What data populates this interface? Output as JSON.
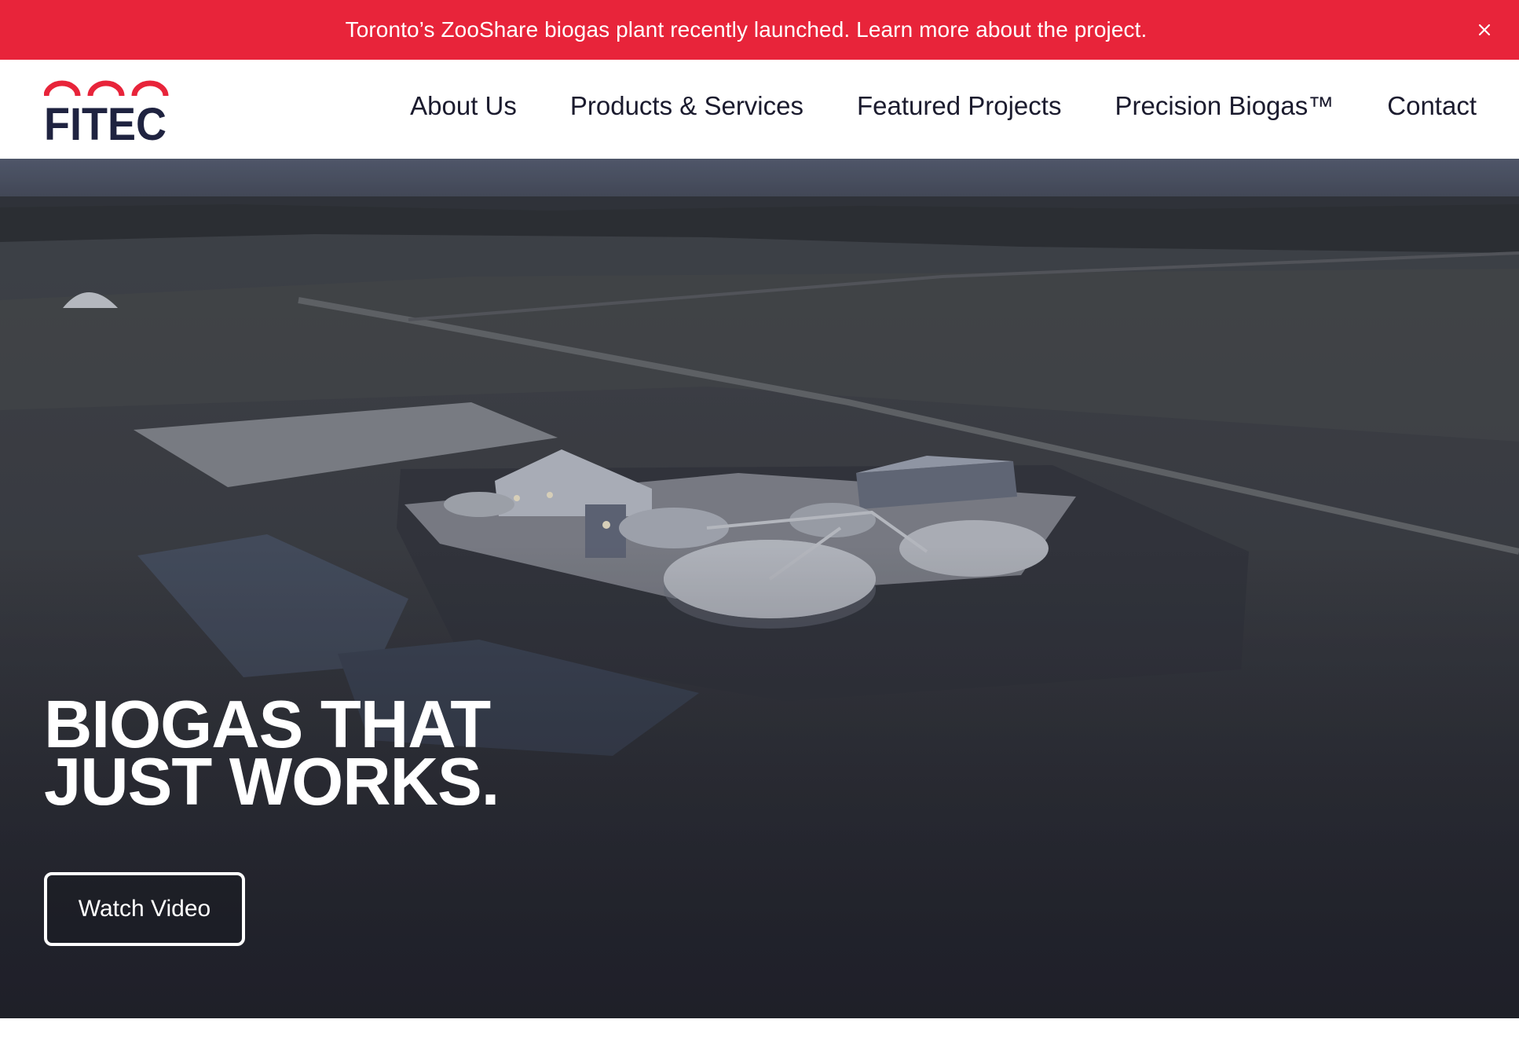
{
  "banner": {
    "text": "Toronto’s ZooShare biogas plant recently launched. Learn more about the project.",
    "close_icon": "close-icon",
    "background_color": "#e8243a"
  },
  "header": {
    "logo_text": "FITEC",
    "logo_icon": "three-arches-logo-mark",
    "logo_colors": {
      "arches": "#e8243a",
      "text": "#1f2340"
    },
    "nav": [
      {
        "label": "About Us"
      },
      {
        "label": "Products & Services"
      },
      {
        "label": "Featured Projects"
      },
      {
        "label": "Precision Biogas™"
      },
      {
        "label": "Contact"
      }
    ]
  },
  "hero": {
    "background": "aerial-dusk-photo-of-biogas-plant",
    "title_line1": "BIOGAS THAT",
    "title_line2": "JUST WORKS.",
    "cta_label": "Watch Video"
  }
}
